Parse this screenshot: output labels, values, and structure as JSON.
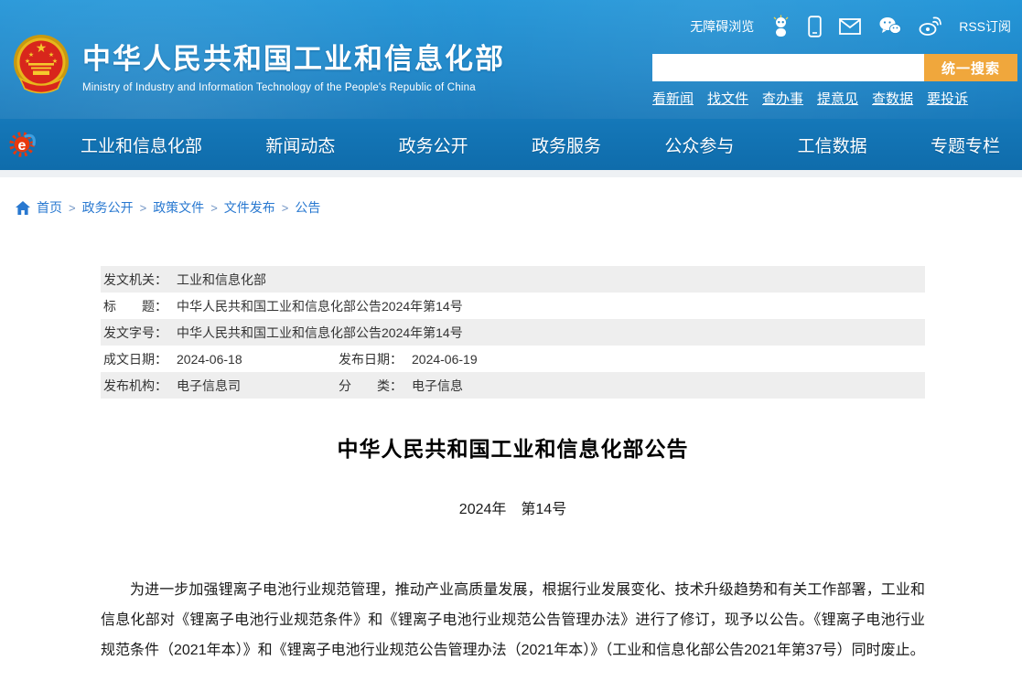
{
  "header": {
    "utility": {
      "accessibility_label": "无障碍浏览",
      "rss_label": "RSS订阅"
    },
    "logo": {
      "title": "中华人民共和国工业和信息化部",
      "subtitle": "Ministry of Industry and Information Technology of the People's Republic of China"
    },
    "search": {
      "value": "",
      "button_label": "统一搜索"
    },
    "quick_links": [
      "看新闻",
      "找文件",
      "查办事",
      "提意见",
      "查数据",
      "要投诉"
    ]
  },
  "nav": {
    "items": [
      "工业和信息化部",
      "新闻动态",
      "政务公开",
      "政务服务",
      "公众参与",
      "工信数据",
      "专题专栏"
    ]
  },
  "breadcrumb": {
    "separator": ">",
    "items": [
      "首页",
      "政务公开",
      "政策文件",
      "文件发布",
      "公告"
    ]
  },
  "document": {
    "meta_rows": [
      {
        "cells": [
          {
            "label": "发文机关：",
            "value": "工业和信息化部"
          }
        ]
      },
      {
        "cells": [
          {
            "label": "标　　题：",
            "value": "中华人民共和国工业和信息化部公告2024年第14号"
          }
        ]
      },
      {
        "cells": [
          {
            "label": "发文字号：",
            "value": "中华人民共和国工业和信息化部公告2024年第14号"
          }
        ]
      },
      {
        "cells": [
          {
            "label": "成文日期：",
            "value": "2024-06-18"
          },
          {
            "label": "发布日期：",
            "value": "2024-06-19"
          }
        ]
      },
      {
        "cells": [
          {
            "label": "发布机构：",
            "value": "电子信息司"
          },
          {
            "label": "分　　类：",
            "value": "电子信息"
          }
        ]
      }
    ],
    "title": "中华人民共和国工业和信息化部公告",
    "doc_number": "2024年　第14号",
    "body": "为进一步加强锂离子电池行业规范管理，推动产业高质量发展，根据行业发展变化、技术升级趋势和有关工作部署，工业和信息化部对《锂离子电池行业规范条件》和《锂离子电池行业规范公告管理办法》进行了修订，现予以公告。《锂离子电池行业规范条件（2021年本）》和《锂离子电池行业规范公告管理办法（2021年本）》（工业和信息化部公告2021年第37号）同时废止。"
  },
  "icons": [
    "national-emblem",
    "robot-mascot-icon",
    "mobile-icon",
    "mail-icon",
    "wechat-icon",
    "weibo-icon",
    "home-icon",
    "miit-e-logo-icon"
  ],
  "colors": {
    "header_blue_top": "#2496d8",
    "header_blue_bottom": "#1879ba",
    "nav_blue": "#0f6cab",
    "accent_orange": "#f0a73c",
    "link_blue": "#2878d0",
    "meta_row_gray": "#eeeeee",
    "emblem_red": "#d8261c",
    "emblem_gold": "#e8b61c"
  }
}
